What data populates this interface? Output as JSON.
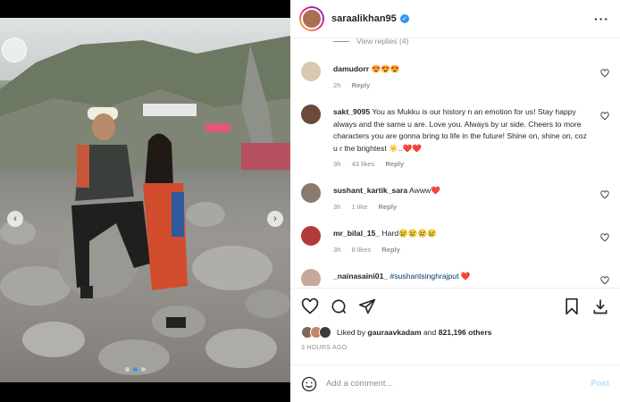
{
  "post": {
    "username": "saraalikhan95",
    "verified": true
  },
  "view_replies": "View replies (4)",
  "comments": [
    {
      "user": "damudorr",
      "text": "😍😍😍",
      "time": "2h",
      "likes": "",
      "reply": "Reply",
      "avatar_color": "#d9c8b0"
    },
    {
      "user": "sakt_9095",
      "text": "You as Mukku is our history n an emotion for us! Stay happy always and the same u are. Love you. Always by ur side. Cheers to more characters you are gonna bring to life in the future! Shine on, shine on, coz u r the brightest ☀️..❤️❤️",
      "time": "3h",
      "likes": "43 likes",
      "reply": "Reply",
      "avatar_color": "#6b4a3a"
    },
    {
      "user": "sushant_kartik_sara",
      "text": "Awww❤️",
      "time": "3h",
      "likes": "1 like",
      "reply": "Reply",
      "avatar_color": "#8a7a6e"
    },
    {
      "user": "mr_bilal_15_",
      "text": "Hard😢😢😢😢",
      "time": "3h",
      "likes": "8 likes",
      "reply": "Reply",
      "avatar_color": "#b33a3a"
    },
    {
      "user": "_nainasaini01_",
      "mention": "#sushantsinghrajput",
      "text": "❤️",
      "avatar_color": "#c9a79a"
    }
  ],
  "liked_by": {
    "prefix": "Liked by",
    "user": "gauraavkadam",
    "and": "and",
    "count": "821,196 others"
  },
  "timestamp": "3 HOURS AGO",
  "add_comment": {
    "emoji_icon": "smiley-icon",
    "placeholder": "Add a comment...",
    "post_label": "Post"
  },
  "carousel": {
    "prev_arrow": "‹",
    "next_arrow": "›",
    "slide_index": 1,
    "slide_count": 3
  }
}
